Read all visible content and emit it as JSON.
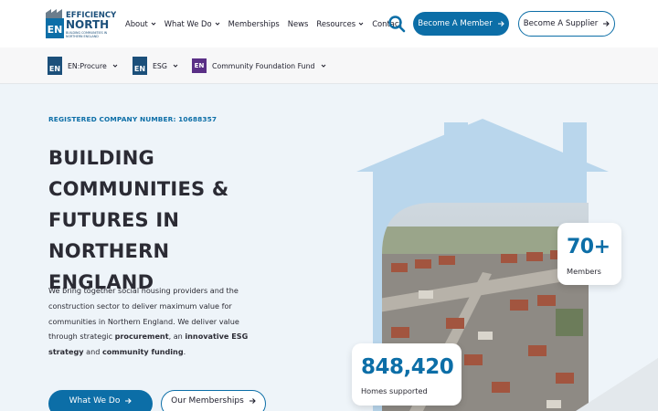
{
  "header": {
    "logo": {
      "mark": "EN",
      "name_line1": "EFFICIENCY",
      "name_line2": "NORTH",
      "tagline_line1": "BUILDING COMMUNITIES IN",
      "tagline_line2": "NORTHERN ENGLAND"
    },
    "nav": [
      {
        "label": "About",
        "has_dropdown": true
      },
      {
        "label": "What We Do",
        "has_dropdown": true
      },
      {
        "label": "Memberships",
        "has_dropdown": false
      },
      {
        "label": "News",
        "has_dropdown": false
      },
      {
        "label": "Resources",
        "has_dropdown": true
      },
      {
        "label": "Contact",
        "has_dropdown": false
      }
    ],
    "search_icon": "search-icon",
    "become_member": "Become A Member",
    "become_supplier": "Become A Supplier"
  },
  "subnav": [
    {
      "label": "EN:Procure",
      "badge": "EN"
    },
    {
      "label": "ESG",
      "badge": "EN"
    },
    {
      "label": "Community Foundation Fund",
      "badge": "EN"
    }
  ],
  "hero": {
    "registered": "REGISTERED COMPANY NUMBER: 10688357",
    "headline_lines": [
      "BUILDING",
      "COMMUNITIES &",
      "FUTURES IN NORTHERN",
      "ENGLAND"
    ],
    "intro": {
      "t1": "We bring together social housing providers and the construction sector to deliver maximum value for communities in Northern England. We deliver value through strategic ",
      "b1": "procurement",
      "t2": ", an ",
      "b2": "innovative ESG strategy",
      "t3": " and ",
      "b3": "community funding",
      "t4": "."
    },
    "cta_primary": "What We Do",
    "cta_secondary": "Our Memberships"
  },
  "stats": {
    "members": {
      "value": "70+",
      "label": "Members"
    },
    "homes": {
      "value": "848,420",
      "label": "Homes supported"
    }
  },
  "colors": {
    "brand_blue": "#0c6ea7",
    "navy": "#1b4f7a",
    "purple": "#5a2f86",
    "house_light": "#b9d6ec",
    "background": "#eef4f9"
  }
}
